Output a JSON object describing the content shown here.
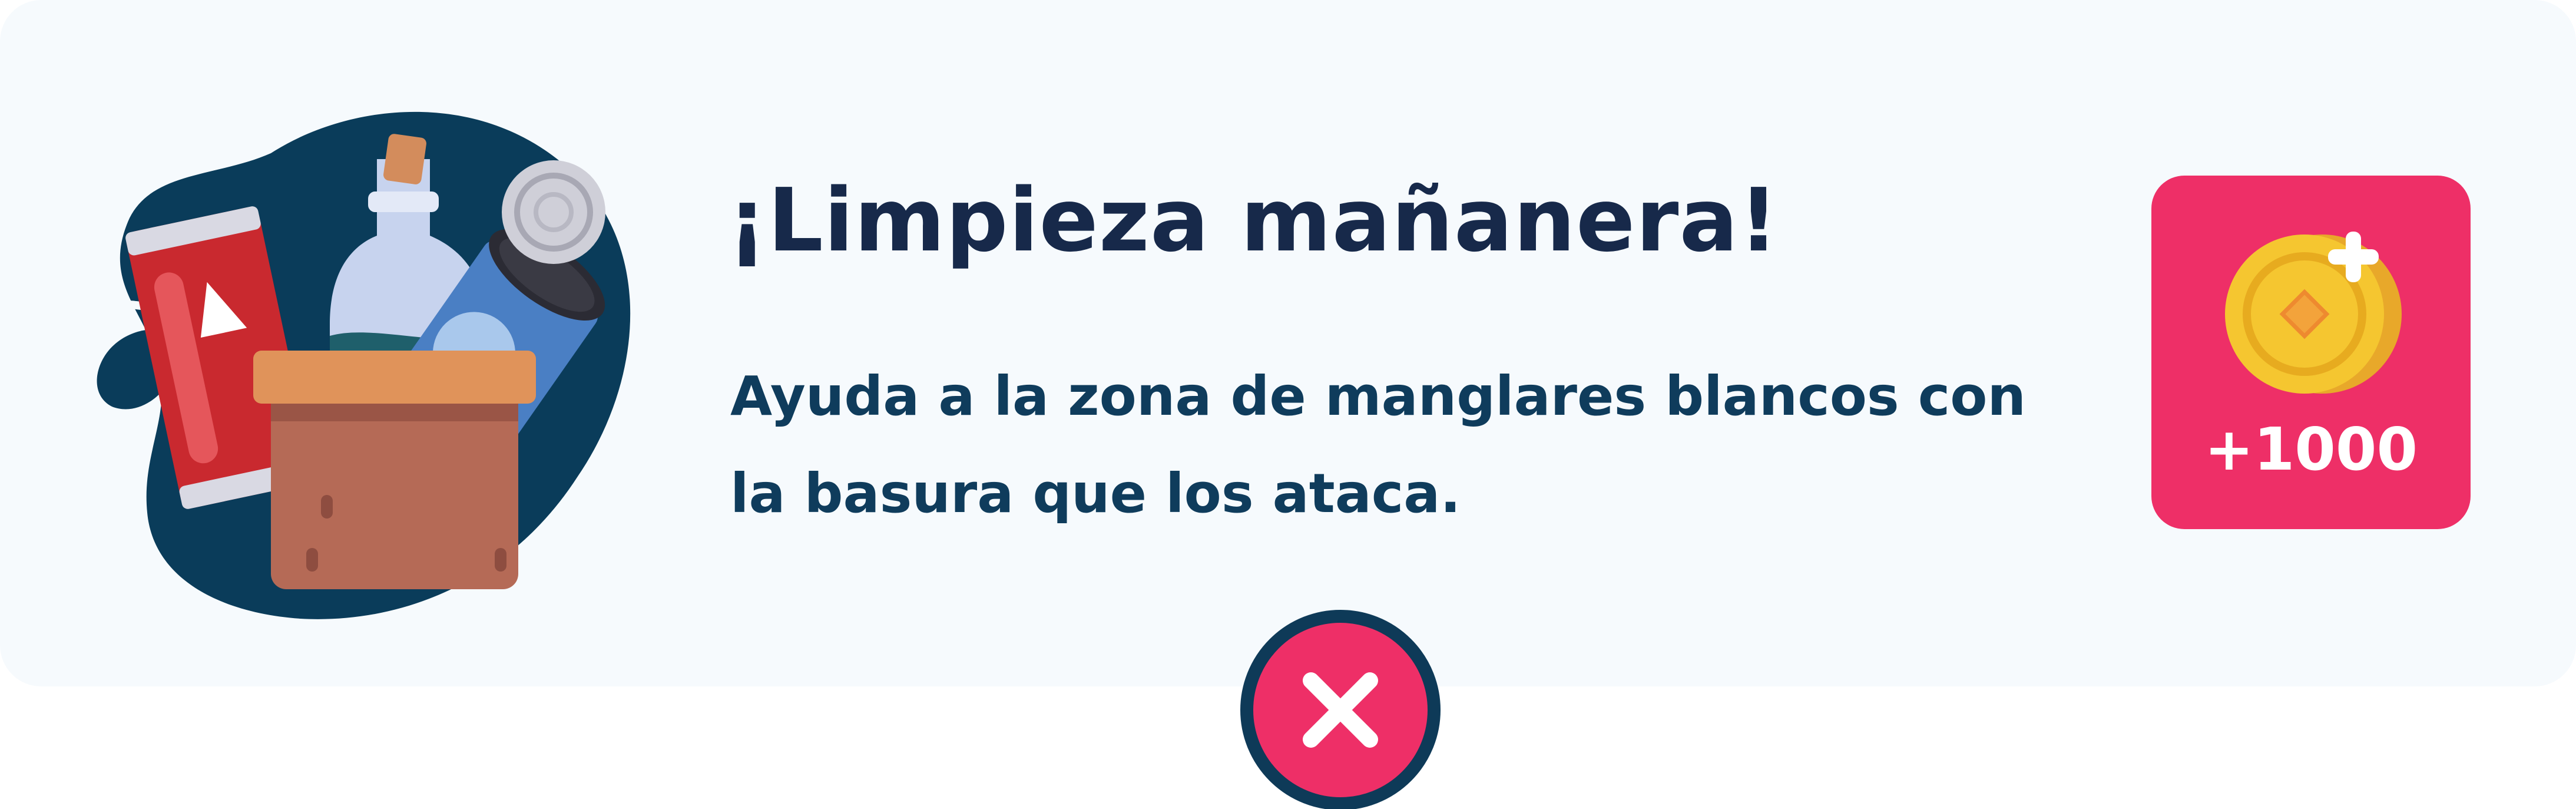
{
  "mission": {
    "title": "¡Limpieza mañanera!",
    "description": "Ayuda a la zona de manglares blancos con la basura que los ataca.",
    "illustration_icon": "trash-box-icon"
  },
  "reward": {
    "amount": "+1000",
    "icon": "coin-plus-icon"
  },
  "close": {
    "icon": "close-icon"
  },
  "colors": {
    "card_background": "#f6fafd",
    "title_text": "#17294a",
    "description_text": "#0f3c5c",
    "accent_pink": "#ee2f67",
    "dark_navy": "#0e3a58",
    "coin_gold": "#f5c630"
  }
}
